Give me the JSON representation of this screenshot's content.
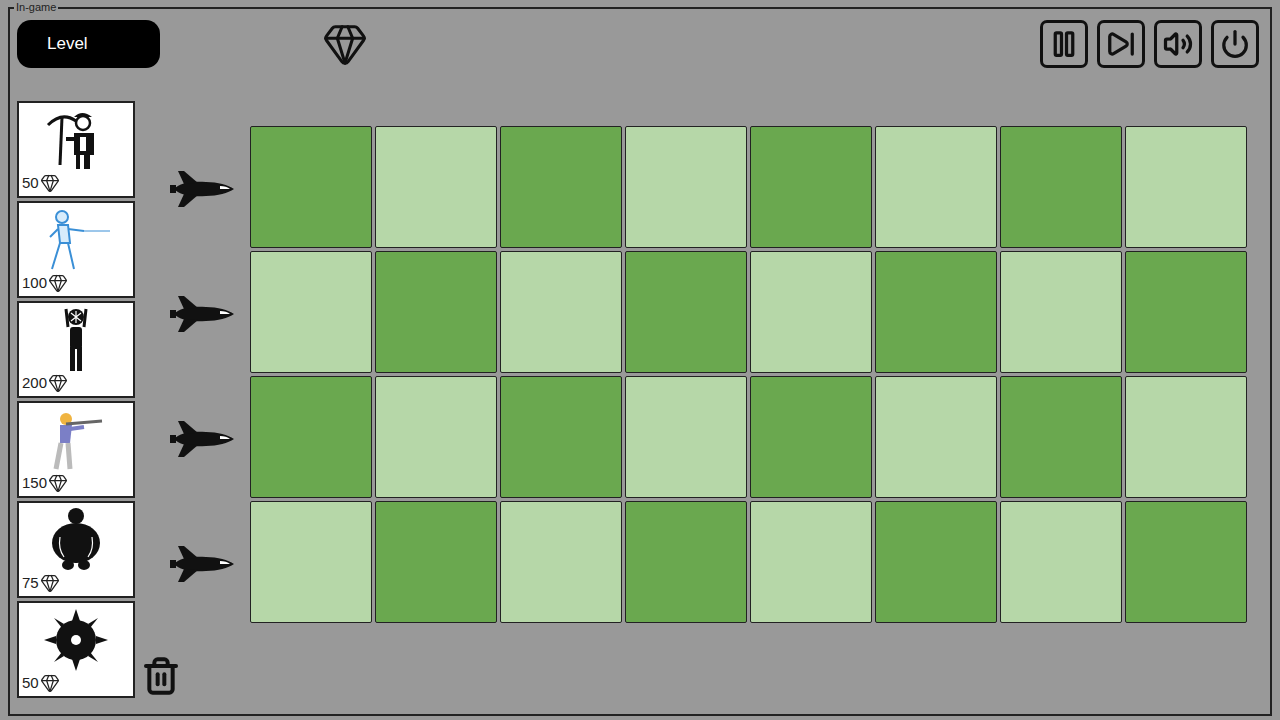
{
  "frame": {
    "title": "In-game"
  },
  "level": {
    "label": "Level"
  },
  "toolbar": [
    {
      "kind": "pause"
    },
    {
      "kind": "fast-forward"
    },
    {
      "kind": "sound"
    },
    {
      "kind": "power"
    }
  ],
  "units": [
    {
      "kind": "miner",
      "cost": "50"
    },
    {
      "kind": "fencer",
      "cost": "100"
    },
    {
      "kind": "bomber",
      "cost": "200"
    },
    {
      "kind": "rifleman",
      "cost": "150"
    },
    {
      "kind": "heavy",
      "cost": "75"
    },
    {
      "kind": "mine",
      "cost": "50"
    }
  ],
  "lanes": [
    {
      "cells": [
        {
          "kind": "dark"
        },
        {
          "kind": "light"
        },
        {
          "kind": "dark"
        },
        {
          "kind": "light"
        },
        {
          "kind": "dark"
        },
        {
          "kind": "light"
        },
        {
          "kind": "dark"
        },
        {
          "kind": "light"
        }
      ]
    },
    {
      "cells": [
        {
          "kind": "light"
        },
        {
          "kind": "dark"
        },
        {
          "kind": "light"
        },
        {
          "kind": "dark"
        },
        {
          "kind": "light"
        },
        {
          "kind": "dark"
        },
        {
          "kind": "light"
        },
        {
          "kind": "dark"
        }
      ]
    },
    {
      "cells": [
        {
          "kind": "dark"
        },
        {
          "kind": "light"
        },
        {
          "kind": "dark"
        },
        {
          "kind": "light"
        },
        {
          "kind": "dark"
        },
        {
          "kind": "light"
        },
        {
          "kind": "dark"
        },
        {
          "kind": "light"
        }
      ]
    },
    {
      "cells": [
        {
          "kind": "light"
        },
        {
          "kind": "dark"
        },
        {
          "kind": "light"
        },
        {
          "kind": "dark"
        },
        {
          "kind": "light"
        },
        {
          "kind": "dark"
        },
        {
          "kind": "light"
        },
        {
          "kind": "dark"
        }
      ]
    }
  ]
}
